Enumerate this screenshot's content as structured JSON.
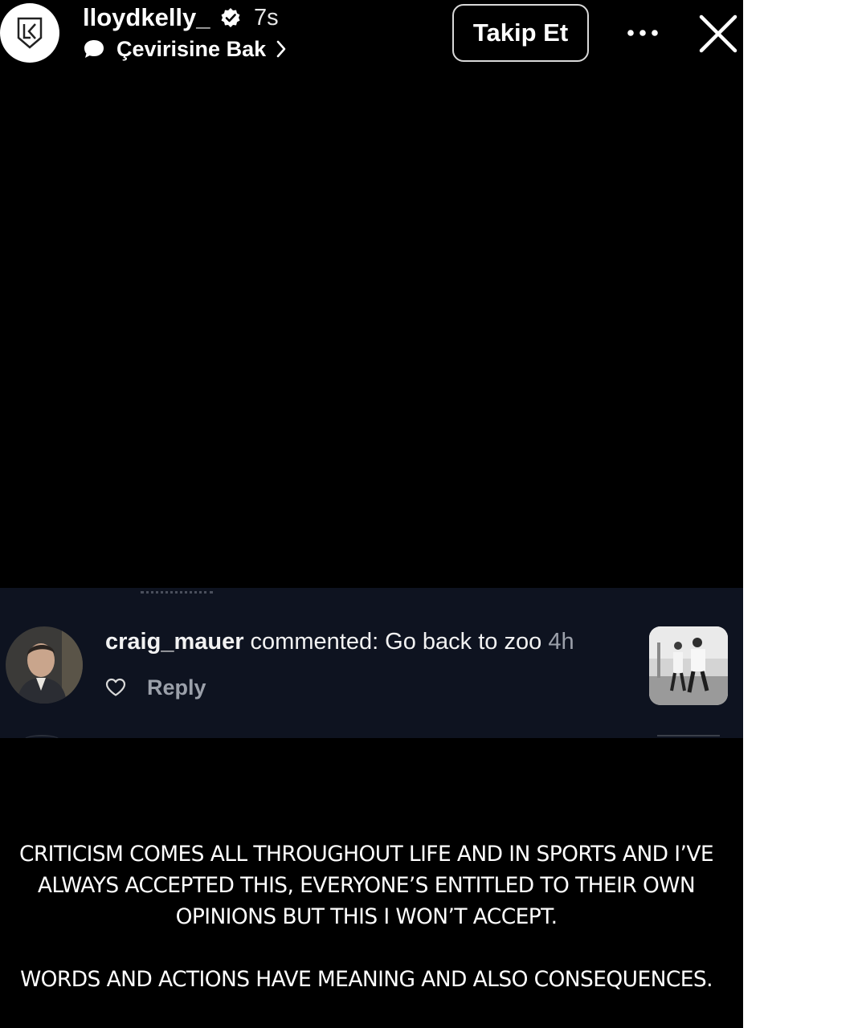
{
  "header": {
    "username": "lloydkelly_",
    "verified_icon": "verified-badge-icon",
    "time_ago": "7s",
    "translate_label": "Çevirisine Bak",
    "follow_label": "Takip Et",
    "more_icon": "more-dots-icon",
    "close_icon": "close-icon"
  },
  "comment": {
    "username": "craig_mauer",
    "text": " commented: Go back to zoo ",
    "age": "4h",
    "reply_label": "Reply",
    "like_icon": "heart-icon"
  },
  "statement": {
    "paragraph1": "CRITICISM COMES ALL THROUGHOUT LIFE AND IN SPORTS AND I’VE ALWAYS ACCEPTED THIS, EVERYONE’S ENTITLED TO THEIR OWN OPINIONS BUT THIS I WON’T ACCEPT.",
    "paragraph2": "WORDS AND ACTIONS HAVE MEANING AND ALSO CONSEQUENCES."
  },
  "colors": {
    "story_background": "#000000",
    "comment_card": "#0e1320",
    "muted_text": "#9ba0aa"
  }
}
